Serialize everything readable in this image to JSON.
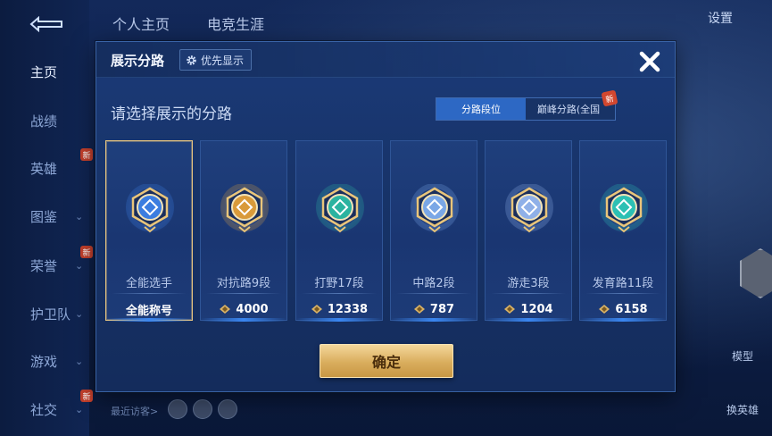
{
  "background": {
    "top_tabs": [
      "个人主页",
      "电竞生涯"
    ],
    "settings_label": "设置",
    "sidebar": [
      {
        "label": "主页",
        "active": true,
        "chevron": false,
        "new": false
      },
      {
        "label": "战绩",
        "active": false,
        "chevron": false,
        "new": false
      },
      {
        "label": "英雄",
        "active": false,
        "chevron": false,
        "new": true
      },
      {
        "label": "图鉴",
        "active": false,
        "chevron": true,
        "new": false
      },
      {
        "label": "荣誉",
        "active": false,
        "chevron": true,
        "new": true
      },
      {
        "label": "护卫队",
        "active": false,
        "chevron": true,
        "new": false
      },
      {
        "label": "游戏",
        "active": false,
        "chevron": true,
        "new": false
      },
      {
        "label": "社交",
        "active": false,
        "chevron": true,
        "new": true
      }
    ],
    "new_badge_text": "新",
    "recent_visitors_label": "最近访客>",
    "right_buttons": [
      "模型",
      "换英雄"
    ]
  },
  "modal": {
    "title": "展示分路",
    "priority_button": "优先显示",
    "subtitle": "请选择展示的分路",
    "toggle": {
      "options": [
        "分路段位",
        "巅峰分路(全国"
      ],
      "selected_index": 0,
      "new_badge": "新"
    },
    "cards": [
      {
        "label": "全能选手",
        "value": "全能称号",
        "selected": true,
        "emblem": "all-round-emblem-icon",
        "color": "#3b7de0"
      },
      {
        "label": "对抗路9段",
        "value": "4000",
        "selected": false,
        "emblem": "clash-lane-emblem-icon",
        "color": "#d99a3a"
      },
      {
        "label": "打野17段",
        "value": "12338",
        "selected": false,
        "emblem": "jungle-emblem-icon",
        "color": "#2bb3a0"
      },
      {
        "label": "中路2段",
        "value": "787",
        "selected": false,
        "emblem": "mid-lane-emblem-icon",
        "color": "#7aa7e6"
      },
      {
        "label": "游走3段",
        "value": "1204",
        "selected": false,
        "emblem": "roam-emblem-icon",
        "color": "#8fb0e8"
      },
      {
        "label": "发育路11段",
        "value": "6158",
        "selected": false,
        "emblem": "farm-lane-emblem-icon",
        "color": "#2cc0b4"
      }
    ],
    "confirm_button": "确定"
  },
  "colors": {
    "accent_blue": "#2d68c4",
    "gold": "#d9ad5d",
    "selected_border": "#e8c580"
  }
}
